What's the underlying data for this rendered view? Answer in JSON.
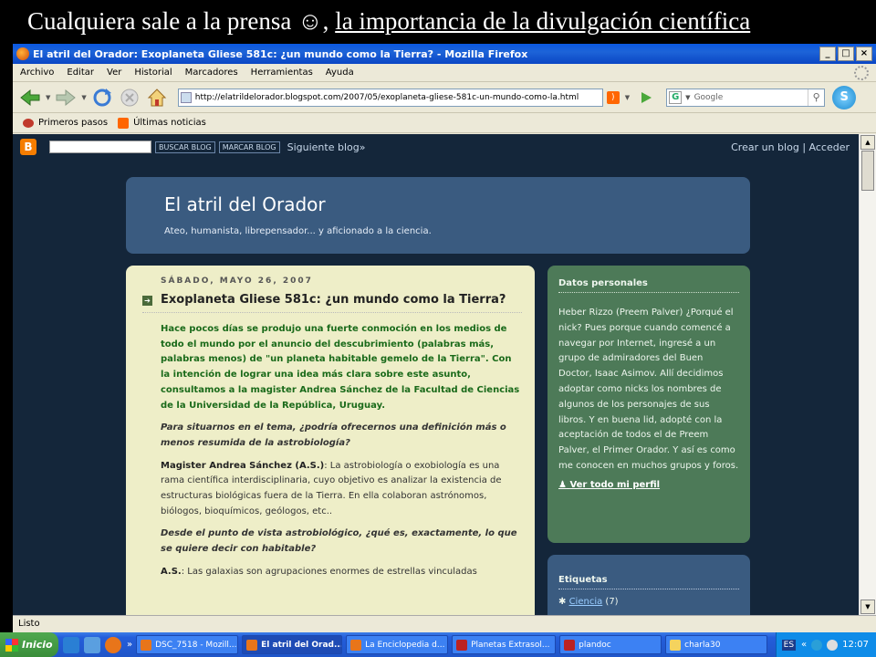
{
  "slide": {
    "title_plain": "Cualquiera sale a la prensa ☺, ",
    "title_underlined": "la importancia de la divulgación científica"
  },
  "window": {
    "title": "El atril del Orador: Exoplaneta Gliese 581c: ¿un mundo como la Tierra? - Mozilla Firefox"
  },
  "menu": [
    "Archivo",
    "Editar",
    "Ver",
    "Historial",
    "Marcadores",
    "Herramientas",
    "Ayuda"
  ],
  "toolbar": {
    "url": "http://elatrildelorador.blogspot.com/2007/05/exoplaneta-gliese-581c-un-mundo-como-la.html",
    "search_placeholder": "Google",
    "search_engine_letter": "G"
  },
  "bookmarks": [
    "Primeros pasos",
    "Últimas noticias"
  ],
  "blogger_nav": {
    "search_button": "BUSCAR BLOG",
    "flag_button": "MARCAR BLOG",
    "next": "Siguiente blog»",
    "create": "Crear un blog",
    "sep": "|",
    "login": "Acceder"
  },
  "blog": {
    "title": "El atril del Orador",
    "description": "Ateo, humanista, librepensador... y aficionado a la ciencia."
  },
  "post": {
    "date": "SÁBADO, MAYO 26, 2007",
    "title": "Exoplaneta Gliese 581c: ¿un mundo como la Tierra?",
    "intro": "Hace pocos días se produjo una fuerte conmoción en los medios de todo el mundo por el anuncio del descubrimiento (palabras más, palabras menos) de \"un planeta habitable gemelo de la Tierra\". Con la intención de lograr una idea más clara sobre este asunto, consultamos a la magister Andrea Sánchez de la Facultad de Ciencias de la Universidad de la República, Uruguay.",
    "q1": "Para situarnos en el tema, ¿podría ofrecernos una definición más o menos resumida de la astrobiología?",
    "a1_speaker": "Magister Andrea Sánchez (A.S.)",
    "a1_text": ": La astrobiología o exobiología es una rama científica interdisciplinaria, cuyo objetivo es analizar la existencia de estructuras biológicas fuera de la Tierra. En ella colaboran astrónomos, biólogos, bioquímicos, geólogos, etc..",
    "q2": "Desde el punto de vista astrobiológico, ¿qué es, exactamente, lo que se quiere decir con habitable?",
    "a2_speaker": "A.S.",
    "a2_text": ": Las galaxias son agrupaciones enormes de estrellas vinculadas"
  },
  "profile": {
    "title": "Datos personales",
    "text": "Heber Rizzo (Preem Palver) ¿Porqué el nick? Pues porque cuando comencé a navegar por Internet, ingresé a un grupo de admiradores del Buen Doctor, Isaac Asimov. Allí decidimos adoptar como nicks los nombres de algunos de los personajes de sus libros. Y en buena lid, adopté con la aceptación de todos el de Preem Palver, el Primer Orador. Y así es como me conocen en muchos grupos y foros.",
    "link": "Ver todo mi perfil"
  },
  "labels": {
    "title": "Etiquetas",
    "items": [
      {
        "name": "Ciencia",
        "count": "(7)"
      }
    ]
  },
  "status": "Listo",
  "taskbar": {
    "start": "Inicio",
    "tasks": [
      "DSC_7518 - Mozill...",
      "El atril del Orad...",
      "La Enciclopedia d...",
      "Planetas Extrasol...",
      "plandoc",
      "charla30"
    ],
    "lang": "ES",
    "clock": "12:07"
  },
  "colors": {
    "xp_blue": "#245edb",
    "blog_bg": "#14263a",
    "header": "#3a5b80",
    "post_bg": "#eeeec8",
    "profile_bg": "#4d7a58"
  }
}
